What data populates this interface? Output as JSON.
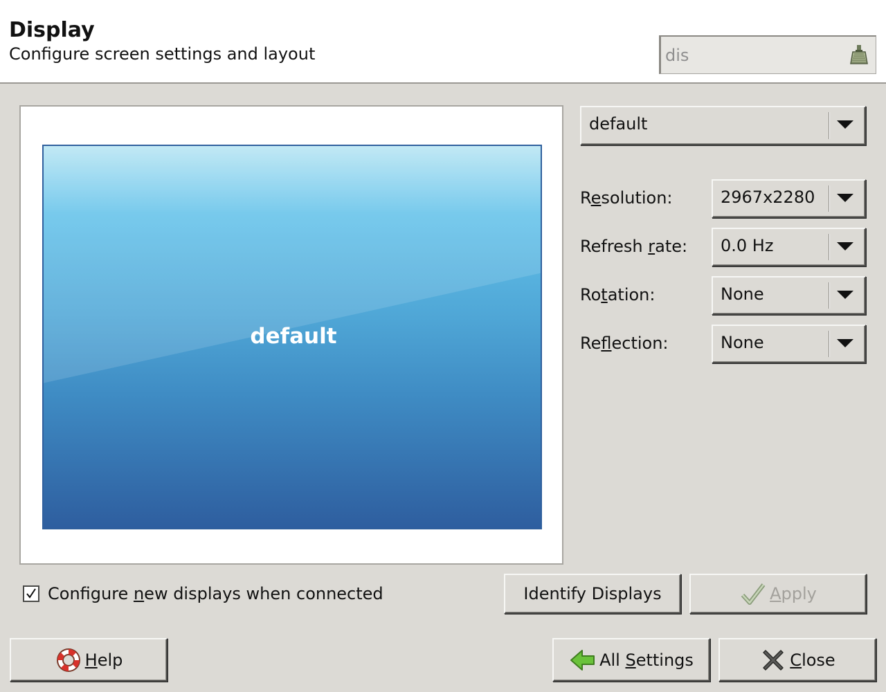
{
  "header": {
    "title": "Display",
    "subtitle": "Configure screen settings and layout",
    "search": {
      "value": "dis",
      "icon": "broom-icon"
    }
  },
  "preview": {
    "monitor_label": "default",
    "colors": {
      "top": "#b9e6f4",
      "bottom": "#2e5e9f"
    }
  },
  "output_selector": {
    "value": "default"
  },
  "settings": {
    "resolution": {
      "label_pre": "R",
      "label_u": "e",
      "label_post": "solution:",
      "value": "2967x2280"
    },
    "refresh": {
      "label_pre": "Refresh ",
      "label_u": "r",
      "label_post": "ate:",
      "value": "0.0 Hz"
    },
    "rotation": {
      "label_pre": "Ro",
      "label_u": "t",
      "label_post": "ation:",
      "value": "None"
    },
    "reflection": {
      "label_pre": "Re",
      "label_u": "f",
      "label_post": "lection:",
      "value": "None"
    }
  },
  "configure_new": {
    "checked": true,
    "label_pre": "Configure ",
    "label_u": "n",
    "label_post": "ew displays when connected"
  },
  "buttons": {
    "identify": "Identify Displays",
    "apply_u": "A",
    "apply_rest": "pply",
    "help_u": "H",
    "help_rest": "elp",
    "all_settings_pre": "All ",
    "all_settings_u": "S",
    "all_settings_post": "ettings",
    "close_u": "C",
    "close_rest": "lose"
  }
}
